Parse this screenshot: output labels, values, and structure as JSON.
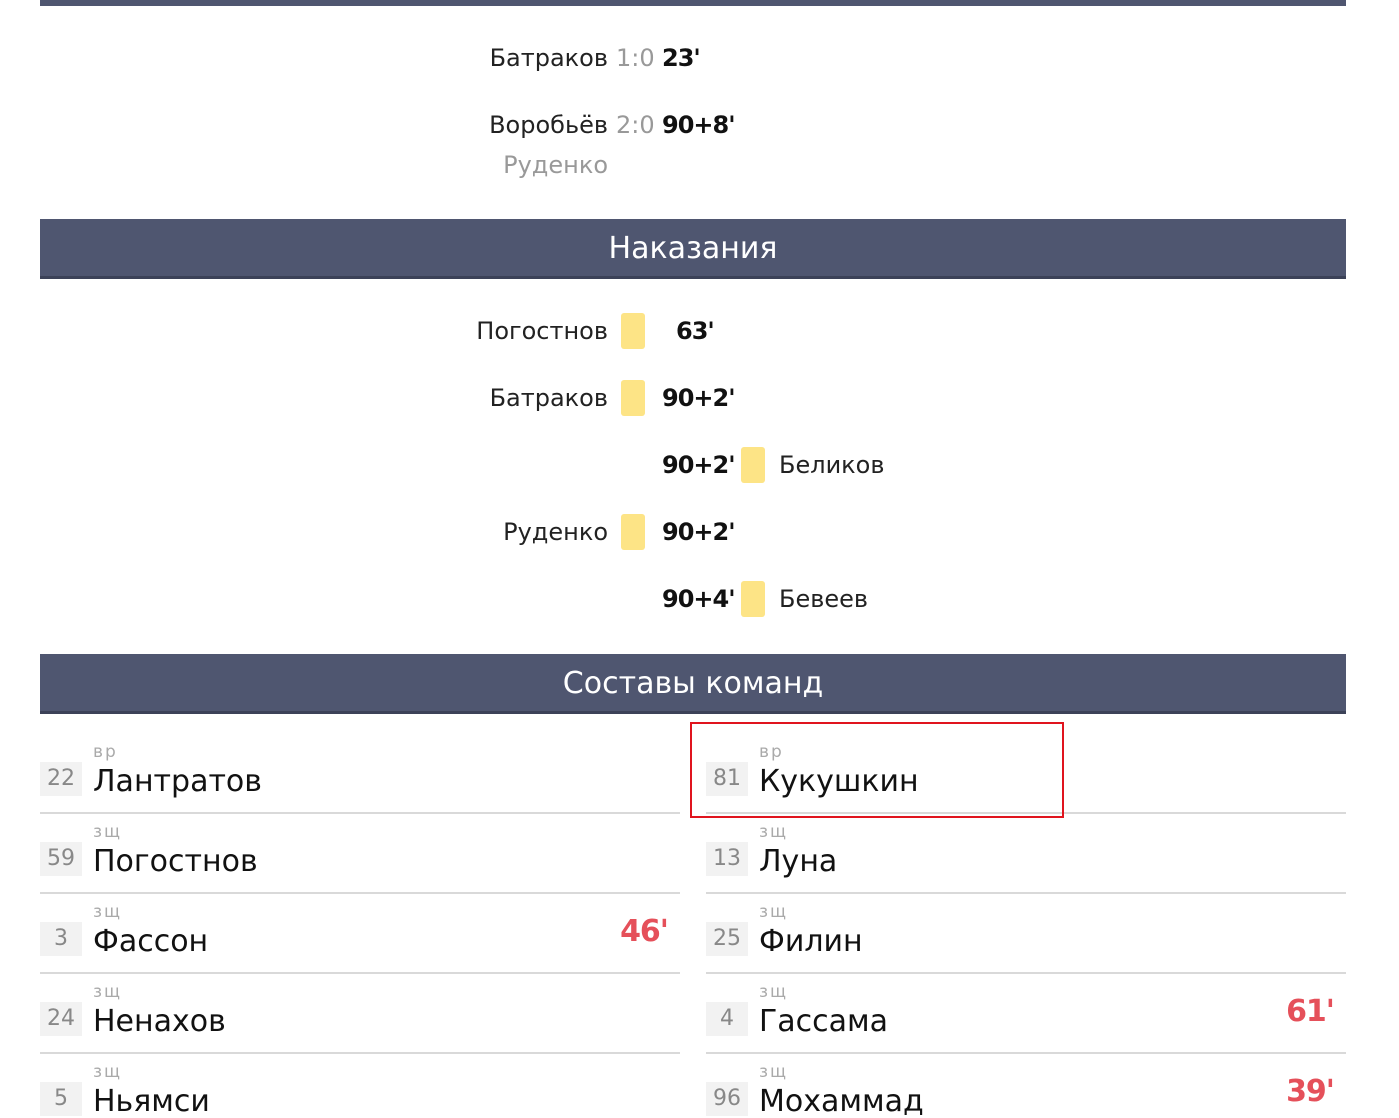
{
  "goals": [
    {
      "scorer": "Батраков",
      "score": "1:0",
      "minute": "23'",
      "assist": ""
    },
    {
      "scorer": "Воробьёв",
      "score": "2:0",
      "minute": "90+8'",
      "assist": "Руденко"
    }
  ],
  "penalties": {
    "title": "Наказания",
    "rows": [
      {
        "home_player": "Погостнов",
        "minute": "63'",
        "away_player": ""
      },
      {
        "home_player": "Батраков",
        "minute": "90+2'",
        "away_player": ""
      },
      {
        "home_player": "",
        "minute": "90+2'",
        "away_player": "Беликов"
      },
      {
        "home_player": "Руденко",
        "minute": "90+2'",
        "away_player": ""
      },
      {
        "home_player": "",
        "minute": "90+4'",
        "away_player": "Бевеев"
      }
    ],
    "card_color": "#fde486"
  },
  "lineups": {
    "title": "Составы команд",
    "home": [
      {
        "number": "22",
        "position": "вр",
        "name": "Лантратов",
        "sub_minute": ""
      },
      {
        "number": "59",
        "position": "зщ",
        "name": "Погостнов",
        "sub_minute": ""
      },
      {
        "number": "3",
        "position": "зщ",
        "name": "Фассон",
        "sub_minute": "46'"
      },
      {
        "number": "24",
        "position": "зщ",
        "name": "Ненахов",
        "sub_minute": ""
      },
      {
        "number": "5",
        "position": "зщ",
        "name": "Ньямси",
        "sub_minute": ""
      }
    ],
    "away": [
      {
        "number": "81",
        "position": "вр",
        "name": "Кукушкин",
        "sub_minute": ""
      },
      {
        "number": "13",
        "position": "зщ",
        "name": "Луна",
        "sub_minute": ""
      },
      {
        "number": "25",
        "position": "зщ",
        "name": "Филин",
        "sub_minute": ""
      },
      {
        "number": "4",
        "position": "зщ",
        "name": "Гассама",
        "sub_minute": "61'"
      },
      {
        "number": "96",
        "position": "зщ",
        "name": "Мохаммад",
        "sub_minute": "39'"
      }
    ]
  },
  "colors": {
    "header_bg": "#4f5670",
    "sub_minute": "#e5505a",
    "highlight": "#e0141e"
  }
}
